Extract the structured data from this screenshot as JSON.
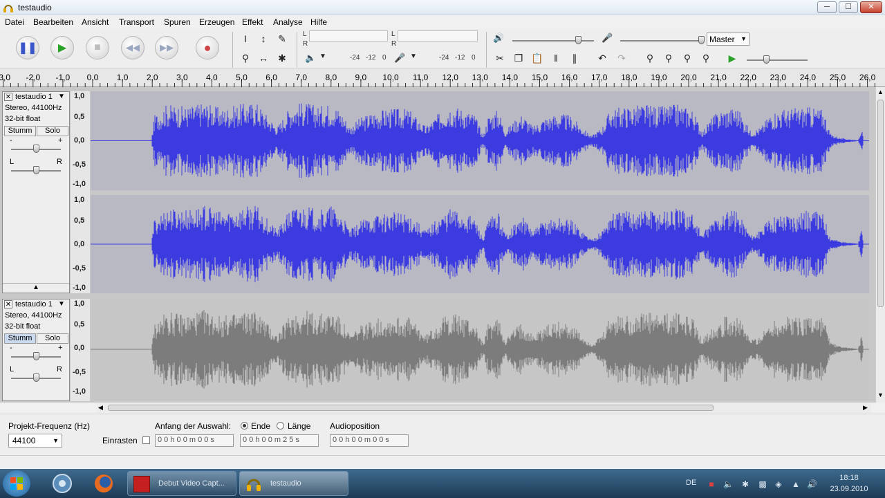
{
  "window": {
    "title": "testaudio",
    "min": "─",
    "max": "☐",
    "close": "✕"
  },
  "menu": [
    "Datei",
    "Bearbeiten",
    "Ansicht",
    "Transport",
    "Spuren",
    "Erzeugen",
    "Effekt",
    "Analyse",
    "Hilfe"
  ],
  "toolbar": {
    "transport_icons": [
      "pause-icon",
      "play-icon",
      "stop-icon",
      "skip-start-icon",
      "skip-end-icon",
      "record-icon"
    ],
    "meter_L": "L",
    "meter_R": "R",
    "meter_scale_1": [
      "-24",
      "-12",
      "0"
    ],
    "meter_scale_2": [
      "-24",
      "-12",
      "0"
    ],
    "mixer_source": "Master"
  },
  "ruler": {
    "ticks": [
      "-3,0",
      "-2,0",
      "-1,0",
      "0,0",
      "1,0",
      "2,0",
      "3,0",
      "4,0",
      "5,0",
      "6,0",
      "7,0",
      "8,0",
      "9,0",
      "10,0",
      "11,0",
      "12,0",
      "13,0",
      "14,0",
      "15,0",
      "16,0",
      "17,0",
      "18,0",
      "19,0",
      "20,0",
      "21,0",
      "22,0",
      "23,0",
      "24,0",
      "25,0",
      "26,0"
    ]
  },
  "tracks": [
    {
      "name": "testaudio 1",
      "info1": "Stereo, 44100Hz",
      "info2": "32-bit float",
      "mute": "Stumm",
      "solo": "Solo",
      "gain_minus": "-",
      "gain_plus": "+",
      "pan_L": "L",
      "pan_R": "R",
      "scale": [
        "1,0",
        "0,5",
        "0,0",
        "-0,5",
        "-1,0"
      ],
      "scale2": [
        "1,0",
        "0,5",
        "0,0",
        "-0,5",
        "-1,0"
      ]
    },
    {
      "name": "testaudio 1",
      "info1": "Stereo, 44100Hz",
      "info2": "32-bit float",
      "mute": "Stumm",
      "solo": "Solo",
      "gain_minus": "-",
      "gain_plus": "+",
      "pan_L": "L",
      "pan_R": "R",
      "scale": [
        "1,0",
        "0,5",
        "0,0",
        "-0,5",
        "-1,0"
      ]
    }
  ],
  "selection": {
    "rate_label": "Projekt-Frequenz (Hz)",
    "rate_value": "44100",
    "snap_label": "Einrasten",
    "start_label": "Anfang der Auswahl:",
    "end_label": "Ende",
    "length_label": "Länge",
    "position_label": "Audioposition",
    "start_value": "0 0 h 0 0 m 0 0 s",
    "end_value": "0 0 h 0 0 m 2 5 s",
    "position_value": "0 0 h 0 0 m 0 0 s"
  },
  "taskbar": {
    "items": [
      "Debut Video Capt...",
      "testaudio"
    ],
    "lang": "DE",
    "time": "18:18",
    "date": "23.09.2010"
  },
  "colors": {
    "wave_selected": "#3b3be0",
    "wave_unselected": "#7c7c7c",
    "wave_bg_selected": "#b9b9c4",
    "wave_bg_unselected": "#c6c6c6"
  }
}
